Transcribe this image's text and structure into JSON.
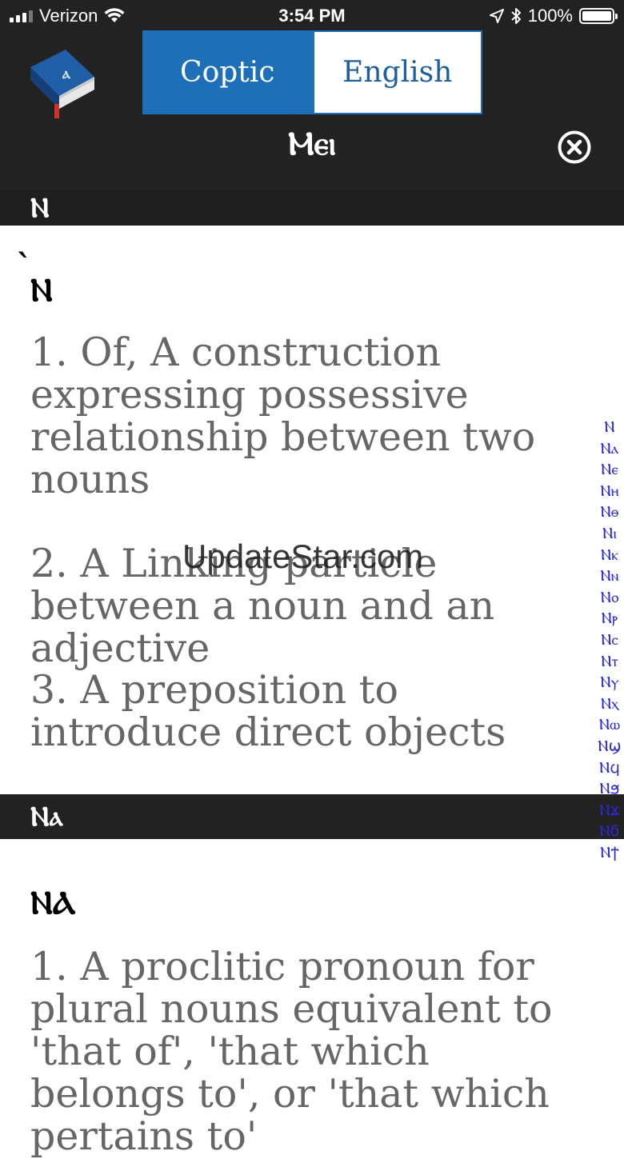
{
  "status_bar": {
    "carrier": "Verizon",
    "time": "3:54 PM",
    "battery": "100%"
  },
  "header": {
    "tabs": [
      {
        "label": "Coptic",
        "active": true
      },
      {
        "label": "English",
        "active": false
      }
    ],
    "title": "Ⲙⲉⲓ",
    "section_letter": "Ⲛ"
  },
  "entries": [
    {
      "word": "Ⲛ",
      "diacritic": "̀",
      "definitions": [
        "1. Of, A construction expressing possessive relationship between two nouns",
        "2. A Linking particle between a noun and an adjective",
        "3. A preposition to introduce direct objects"
      ]
    },
    {
      "section_header": "Ⲛⲁ",
      "word": "ⲚⲀ",
      "definitions": [
        "1. A proclitic pronoun for plural nouns equivalent to 'that of', 'that which belongs to', or 'that which pertains to'"
      ]
    }
  ],
  "index": [
    "Ⲛ",
    "Ⲛⲁ",
    "Ⲛⲉ",
    "Ⲛⲏ",
    "Ⲛⲑ",
    "Ⲛⲓ",
    "Ⲛⲕ",
    "Ⲛⲛ",
    "Ⲛⲟ",
    "Ⲛⲣ",
    "Ⲛⲥ",
    "Ⲛⲧ",
    "Ⲛⲩ",
    "Ⲛⲭ",
    "Ⲛⲱ",
    "Ⲛϣ",
    "Ⲛϥ",
    "Ⲛϧ",
    "Ⲛϫ",
    "Ⲛϭ",
    "Ⲛϯ"
  ],
  "watermark": "UpdateStar.com",
  "colors": {
    "header_bg": "#222222",
    "accent": "#1d6fb8",
    "index_text": "#2a2ad0",
    "definition_text": "#666666"
  }
}
